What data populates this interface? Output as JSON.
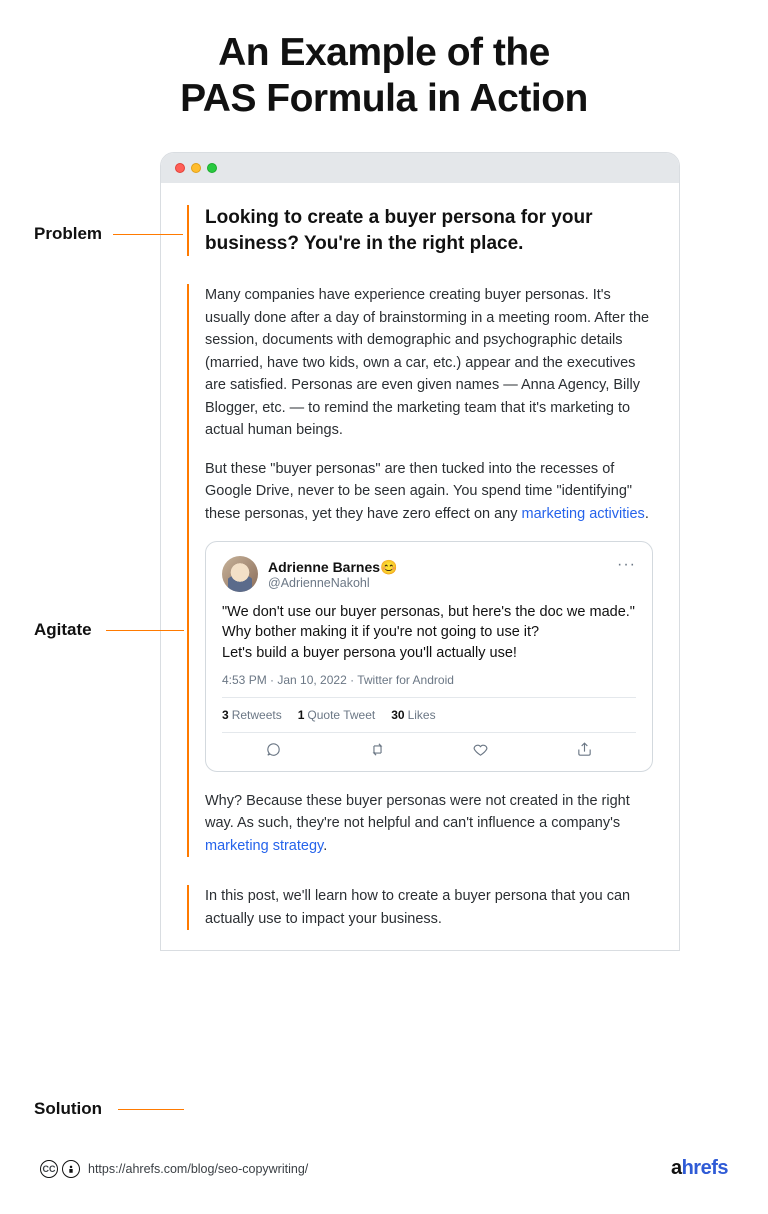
{
  "title_line1": "An Example of the",
  "title_line2": "PAS Formula in Action",
  "labels": {
    "problem": "Problem",
    "agitate": "Agitate",
    "solution": "Solution"
  },
  "problem": {
    "text": "Looking to create a buyer persona for your business? You're in the right place."
  },
  "agitate": {
    "para1": "Many companies have experience creating buyer personas. It's usually done after a day of brainstorming in a meeting room. After the session, documents with demographic and psychographic details (married, have two kids, own a car, etc.) appear and the executives are satisfied. Personas are even given names — Anna Agency, Billy Blogger, etc. — to remind the marketing team that it's marketing to actual human beings.",
    "para2_a": "But these \"buyer personas\" are then tucked into the recesses of Google Drive, never to be seen again. You spend time \"identifying\" these personas, yet they have zero effect on any ",
    "para2_link": "marketing activities",
    "para2_b": ".",
    "tweet": {
      "name": "Adrienne Barnes",
      "emoji": "😊",
      "handle": "@AdrienneNakohl",
      "body_l1": "\"We don't use our buyer personas, but here's the doc we made.\"",
      "body_l2": "Why bother making it if you're not going to use it?",
      "body_l3": "Let's build a buyer persona you'll actually use!",
      "meta": "4:53 PM · Jan 10, 2022 · Twitter for Android",
      "retweets": "3",
      "retweets_label": "Retweets",
      "quotes": "1",
      "quotes_label": "Quote Tweet",
      "likes": "30",
      "likes_label": "Likes"
    },
    "para3_a": "Why? Because these buyer personas were not created in the right way. As such, they're not helpful and can't influence a company's ",
    "para3_link": "marketing strategy",
    "para3_b": "."
  },
  "solution": {
    "text": "In this post, we'll learn how to create a buyer persona that you can actually use to impact your business."
  },
  "footer": {
    "url": "https://ahrefs.com/blog/seo-copywriting/",
    "brand_a": "ahrefs",
    "cc_cc": "cc",
    "cc_by": "🅱"
  }
}
